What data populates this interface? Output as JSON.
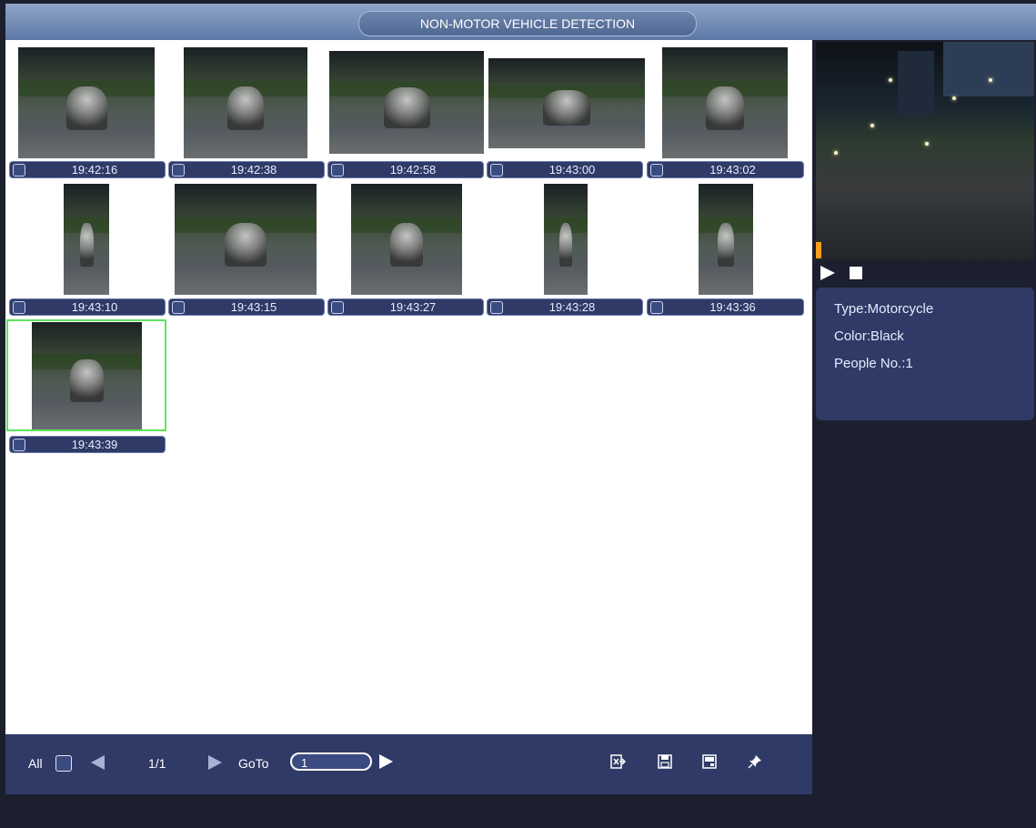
{
  "window": {
    "title": "NON-MOTOR VEHICLE DETECTION"
  },
  "results": [
    {
      "time": "19:42:16"
    },
    {
      "time": "19:42:38"
    },
    {
      "time": "19:42:58"
    },
    {
      "time": "19:43:00"
    },
    {
      "time": "19:43:02"
    },
    {
      "time": "19:43:10"
    },
    {
      "time": "19:43:15"
    },
    {
      "time": "19:43:27"
    },
    {
      "time": "19:43:28"
    },
    {
      "time": "19:43:36"
    },
    {
      "time": "19:43:39"
    }
  ],
  "detail": {
    "type": "Type:Motorcycle",
    "color": "Color:Black",
    "people": "People No.:1"
  },
  "footer": {
    "all_label": "All",
    "page": "1/1",
    "goto_label": "GoTo",
    "goto_value": "1"
  },
  "colors": {
    "selected_outline": "#5ee35c",
    "progress_marker": "#ff9d1d",
    "panel": "#2f3a66"
  },
  "icons": {
    "export": "export-icon",
    "save": "save-icon",
    "backup": "backup-icon",
    "pin": "pin-icon",
    "play": "play-icon",
    "stop": "stop-icon"
  }
}
